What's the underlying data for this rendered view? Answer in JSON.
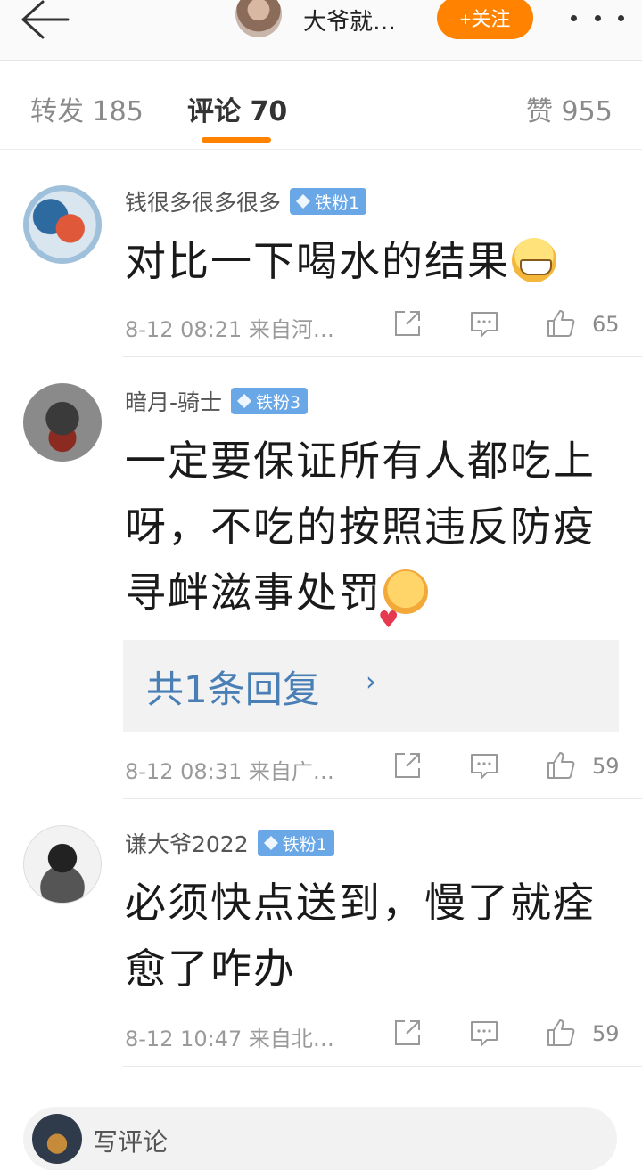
{
  "header": {
    "title": "大爷就…",
    "follow_label": "+关注"
  },
  "tabs": [
    {
      "label": "转发 185"
    },
    {
      "label": "评论 70"
    },
    {
      "label": "赞 955"
    }
  ],
  "comments": [
    {
      "username": "钱很多很多很多",
      "badge": "铁粉1",
      "text": "对比一下喝水的结果",
      "emoji": "grin-emoji",
      "time": "8-12 08:21",
      "source": "来自河…",
      "likes": "65"
    },
    {
      "username": "暗月-骑士",
      "badge": "铁粉3",
      "text": "一定要保证所有人都吃上呀，不吃的按照违反防疫寻衅滋事处罚",
      "emoji": "love-emoji",
      "replies_label": "共1条回复",
      "time": "8-12 08:31",
      "source": "来自广…",
      "likes": "59"
    },
    {
      "username": "谦大爷2022",
      "badge": "铁粉1",
      "text": "必须快点送到，慢了就痊愈了咋办",
      "time": "8-12 10:47",
      "source": "来自北…",
      "likes": "59"
    }
  ],
  "bottom_bar": {
    "placeholder": "写评论"
  },
  "colors": {
    "accent": "#ff8200",
    "badge": "#6aa7e6",
    "link": "#4a7fb6"
  }
}
